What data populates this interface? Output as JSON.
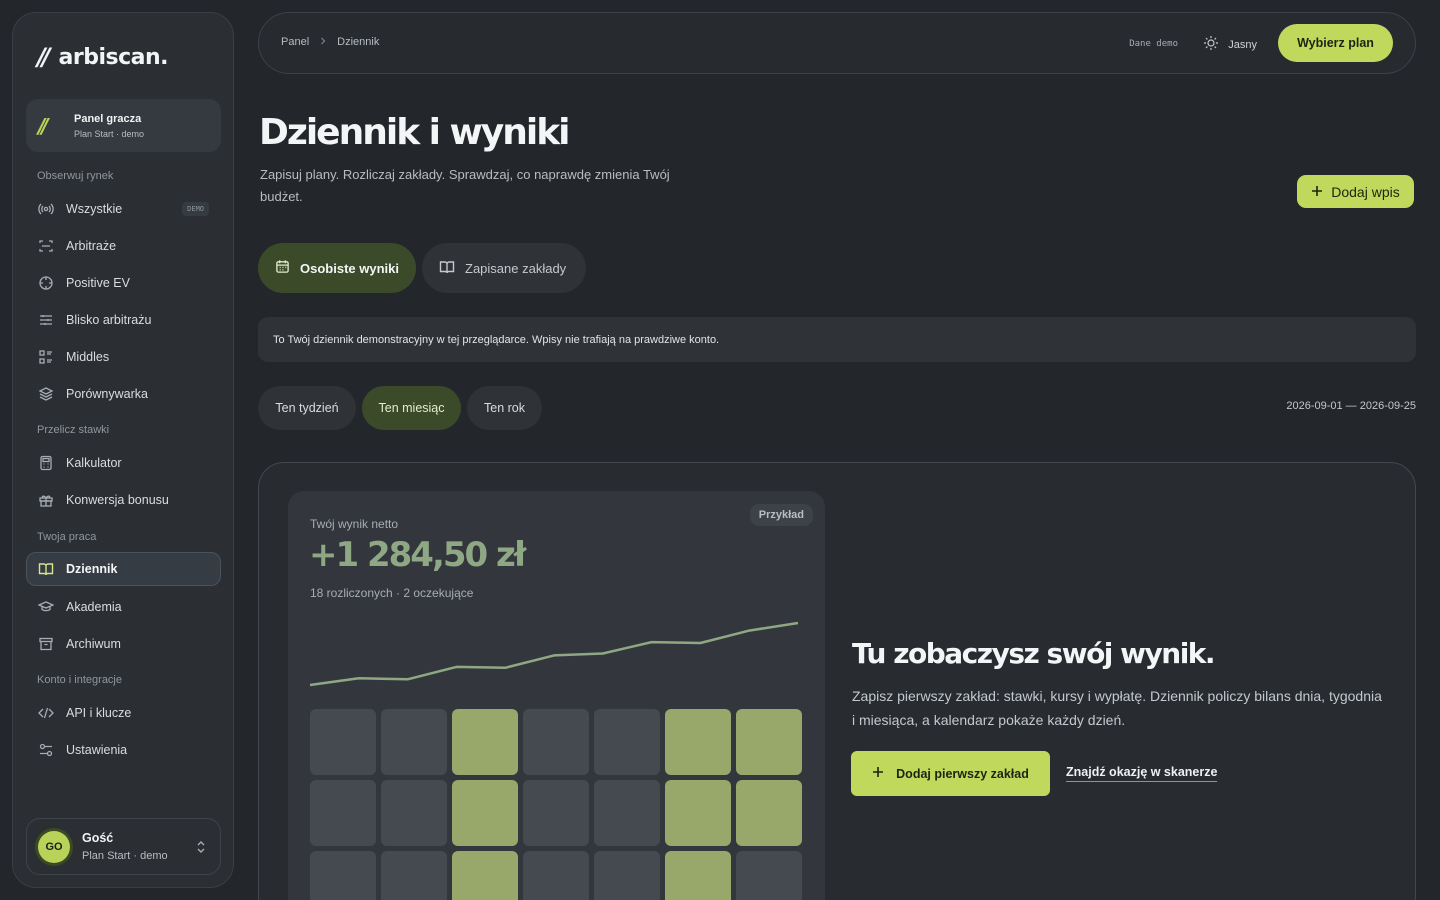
{
  "brand": {
    "mark": "//",
    "name": "arbiscan."
  },
  "plan_card": {
    "mark": "//",
    "title": "Panel gracza",
    "subtitle": "Plan Start · demo"
  },
  "sidebar": {
    "sections": [
      {
        "label": "Obserwuj rynek"
      },
      {
        "label": "Przelicz stawki"
      },
      {
        "label": "Twoja praca"
      },
      {
        "label": "Konto i integracje"
      }
    ],
    "items": [
      {
        "label": "Wszystkie",
        "icon": "broadcast-icon",
        "badge": "DEMO"
      },
      {
        "label": "Arbitraże",
        "icon": "scan-icon"
      },
      {
        "label": "Positive EV",
        "icon": "crosshair-icon"
      },
      {
        "label": "Blisko arbitrażu",
        "icon": "sliders-icon"
      },
      {
        "label": "Middles",
        "icon": "list-icon"
      },
      {
        "label": "Porównywarka",
        "icon": "layers-icon"
      },
      {
        "label": "Kalkulator",
        "icon": "calculator-icon"
      },
      {
        "label": "Konwersja bonusu",
        "icon": "gift-icon"
      },
      {
        "label": "Dziennik",
        "icon": "book-icon",
        "active": true
      },
      {
        "label": "Akademia",
        "icon": "graduation-cap-icon"
      },
      {
        "label": "Archiwum",
        "icon": "archive-icon"
      },
      {
        "label": "API i klucze",
        "icon": "code-icon"
      },
      {
        "label": "Ustawienia",
        "icon": "settings-icon"
      }
    ]
  },
  "user": {
    "initials": "GO",
    "name": "Gość",
    "subtitle": "Plan Start · demo"
  },
  "topbar": {
    "breadcrumb": [
      "Panel",
      "Dziennik"
    ],
    "data_label": "Dane demo",
    "theme_label": "Jasny",
    "plan_button": "Wybierz plan"
  },
  "header": {
    "title": "Dziennik i wyniki",
    "subtitle": "Zapisuj plany. Rozliczaj zakłady. Sprawdzaj, co naprawdę zmienia Twój budżet.",
    "add_button": "Dodaj wpis"
  },
  "tabs": [
    {
      "label": "Osobiste wyniki",
      "active": true
    },
    {
      "label": "Zapisane zakłady",
      "active": false
    }
  ],
  "notice": "To Twój dziennik demonstracyjny w tej przeglądarce. Wpisy nie trafiają na prawdziwe konto.",
  "periods": [
    {
      "label": "Ten tydzień",
      "active": false
    },
    {
      "label": "Ten miesiąc",
      "active": true
    },
    {
      "label": "Ten rok",
      "active": false
    }
  ],
  "date_range": "2026-09-01 — 2026-09-25",
  "preview": {
    "label": "Twój wynik netto",
    "badge": "Przykład",
    "value": "+1 284,50 zł",
    "meta": "18 rozliczonych · 2 oczekujące",
    "sparkline": [
      0,
      0.7,
      0.6,
      1.9,
      1.8,
      3.1,
      3.3,
      4.5,
      4.4,
      5.7,
      6.5
    ],
    "calendar": [
      [
        0,
        0,
        1,
        0,
        0,
        1,
        1
      ],
      [
        0,
        0,
        1,
        0,
        0,
        1,
        1
      ],
      [
        0,
        0,
        1,
        0,
        0,
        1,
        0
      ]
    ],
    "colors": {
      "positive": "#98a86a",
      "neutral": "#454a50",
      "line": "#8fa884"
    }
  },
  "cta": {
    "title": "Tu zobaczysz swój wynik.",
    "text": "Zapisz pierwszy zakład: stawki, kursy i wypłatę. Dziennik policzy bilans dnia, tygodnia i miesiąca, a kalendarz pokaże każdy dzień.",
    "primary": "Dodaj pierwszy zakład",
    "secondary": "Znajdź okazję w skanerze"
  },
  "colors": {
    "accent": "#c0d95c",
    "background": "#23262a",
    "active_tab": "#3b4a29"
  }
}
